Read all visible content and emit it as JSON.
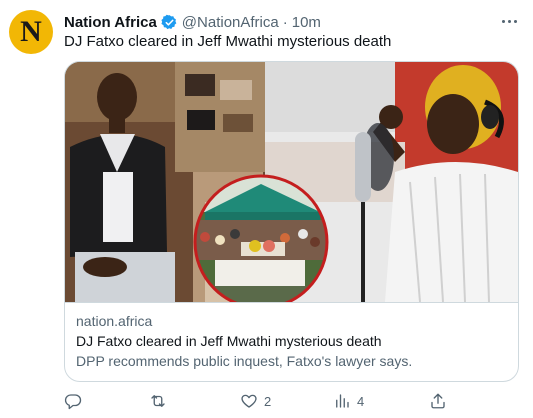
{
  "account": {
    "avatar_letter": "N",
    "name": "Nation Africa",
    "handle": "@NationAfrica",
    "separator": "·",
    "time": "10m"
  },
  "tweet": {
    "text": "DJ Fatxo cleared in Jeff Mwathi mysterious death"
  },
  "card": {
    "domain": "nation.africa",
    "title": "DJ Fatxo cleared in Jeff Mwathi mysterious death",
    "description": "DPP recommends public inquest, Fatxo's lawyer says."
  },
  "actions": {
    "reply_count": "",
    "retweet_count": "",
    "like_count": "2",
    "views_count": "4"
  },
  "icons": {
    "verified": "verified-badge-icon",
    "more": "more-options-icon",
    "reply": "reply-icon",
    "retweet": "retweet-icon",
    "like": "heart-icon",
    "views": "views-chart-icon",
    "share": "share-icon"
  },
  "colors": {
    "avatar_bg": "#f2b705",
    "verified": "#1d9bf0",
    "secondary_text": "#536471",
    "border": "#cfd9de"
  }
}
